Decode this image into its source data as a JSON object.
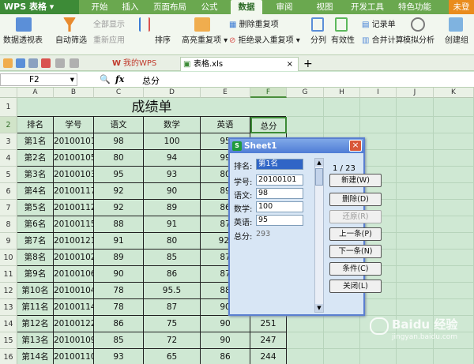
{
  "app": {
    "logo": "WPS 表格"
  },
  "menu": [
    {
      "label": "开始"
    },
    {
      "label": "插入"
    },
    {
      "label": "页面布局"
    },
    {
      "label": "公式"
    },
    {
      "label": "数据"
    },
    {
      "label": "审阅"
    },
    {
      "label": "视图"
    },
    {
      "label": "开发工具"
    },
    {
      "label": "特色功能"
    },
    {
      "label": "未登"
    }
  ],
  "ribbon": {
    "pivot": "数据透视表",
    "autofilter": "自动筛选",
    "showall": "全部显示",
    "reapply": "重新应用",
    "sort": "排序",
    "highlight_dup": "高亮重复项",
    "remove_dup": "删除重复项",
    "reject_dup": "拒绝录入重复项",
    "split": "分列",
    "validity": "有效性",
    "record_form": "记录单",
    "consolidate": "合并计算",
    "whatif": "模拟分析",
    "group": "创建组"
  },
  "quick": {
    "tab1": "我的WPS",
    "tab2": "表格.xls"
  },
  "formula": {
    "namebox": "F2",
    "fx": "fx",
    "value": "总分"
  },
  "columns": [
    "A",
    "B",
    "C",
    "D",
    "E",
    "F",
    "G",
    "H",
    "I",
    "J",
    "K"
  ],
  "rows": [
    "1",
    "2",
    "3",
    "4",
    "5",
    "6",
    "7",
    "8",
    "9",
    "10",
    "11",
    "12",
    "13",
    "14",
    "15",
    "16"
  ],
  "sheet": {
    "title": "成绩单",
    "headers": [
      "排名",
      "学号",
      "语文",
      "数学",
      "英语",
      "总分"
    ],
    "data": [
      [
        "第1名",
        "20100101",
        "98",
        "100",
        "95",
        ""
      ],
      [
        "第2名",
        "20100105",
        "80",
        "94",
        "99",
        ""
      ],
      [
        "第3名",
        "20100103",
        "95",
        "93",
        "80",
        ""
      ],
      [
        "第4名",
        "20100117",
        "92",
        "90",
        "89",
        ""
      ],
      [
        "第5名",
        "20100112",
        "92",
        "89",
        "86",
        ""
      ],
      [
        "第6名",
        "20100115",
        "88",
        "91",
        "87",
        ""
      ],
      [
        "第7名",
        "20100121",
        "91",
        "80",
        "92.",
        ""
      ],
      [
        "第8名",
        "20100102",
        "89",
        "85",
        "87",
        ""
      ],
      [
        "第9名",
        "20100106",
        "90",
        "86",
        "87",
        ""
      ],
      [
        "第10名",
        "20100104",
        "78",
        "95.5",
        "88",
        ""
      ],
      [
        "第11名",
        "20100114",
        "78",
        "87",
        "90",
        ""
      ],
      [
        "第12名",
        "20100122",
        "86",
        "75",
        "90",
        "251"
      ],
      [
        "第13名",
        "20100109",
        "85",
        "72",
        "90",
        "247"
      ],
      [
        "第14名",
        "20100110",
        "93",
        "65",
        "86",
        "244"
      ]
    ]
  },
  "dialog": {
    "title": "Sheet1",
    "counter": "1 / 23",
    "labels": [
      "排名:",
      "学号:",
      "语文:",
      "数学:",
      "英语:",
      "总分:"
    ],
    "values": [
      "第1名",
      "20100101",
      "98",
      "100",
      "95",
      "293"
    ],
    "buttons": [
      "新建(W)",
      "删除(D)",
      "还原(R)",
      "上一条(P)",
      "下一条(N)",
      "条件(C)",
      "关闭(L)"
    ]
  },
  "watermark": {
    "brand": "Baidu 经验",
    "url": "jingyan.baidu.com"
  },
  "colors": {
    "accent": "#6aa84f",
    "grid": "#cfe8d3",
    "dialog": "#d8e6f5"
  }
}
